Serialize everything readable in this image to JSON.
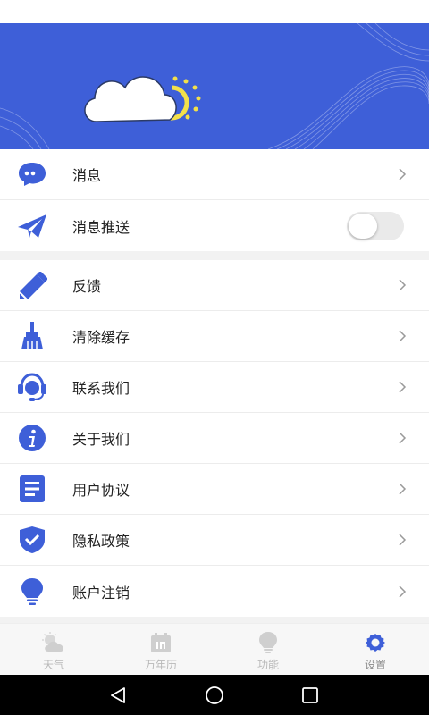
{
  "header": {
    "brand_color": "#3e5fd8",
    "icon": "cloud-sun-icon"
  },
  "menu": {
    "group1": [
      {
        "label": "消息",
        "icon": "chat-bubble-icon",
        "control": "chevron"
      },
      {
        "label": "消息推送",
        "icon": "paper-plane-icon",
        "control": "toggle",
        "toggle_on": false
      }
    ],
    "group2": [
      {
        "label": "反馈",
        "icon": "pencil-icon",
        "control": "chevron"
      },
      {
        "label": "清除缓存",
        "icon": "broom-icon",
        "control": "chevron"
      },
      {
        "label": "联系我们",
        "icon": "headset-icon",
        "control": "chevron"
      },
      {
        "label": "关于我们",
        "icon": "info-icon",
        "control": "chevron"
      },
      {
        "label": "用户协议",
        "icon": "document-icon",
        "control": "chevron"
      },
      {
        "label": "隐私政策",
        "icon": "shield-check-icon",
        "control": "chevron"
      },
      {
        "label": "账户注销",
        "icon": "lightbulb-icon",
        "control": "chevron"
      }
    ]
  },
  "tabbar": {
    "tabs": [
      {
        "label": "天气",
        "icon": "weather-cloud-icon",
        "active": false
      },
      {
        "label": "万年历",
        "icon": "calendar-icon",
        "active": false
      },
      {
        "label": "功能",
        "icon": "bulb-icon",
        "active": false
      },
      {
        "label": "设置",
        "icon": "gear-icon",
        "active": true
      }
    ]
  },
  "colors": {
    "accent": "#3e5fd8",
    "sun": "#f3e04a",
    "tab_inactive": "#c8c8c8"
  }
}
